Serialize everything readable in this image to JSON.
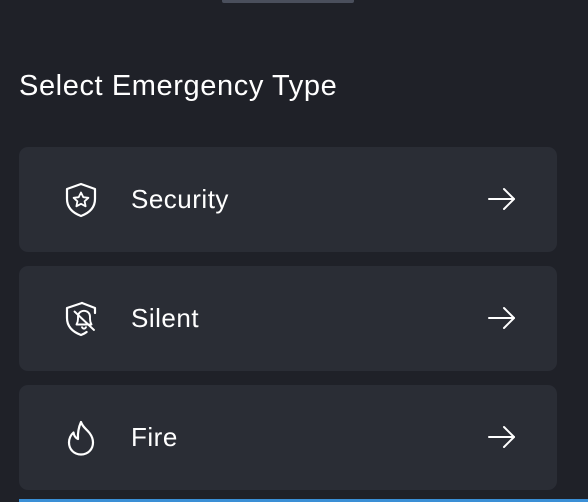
{
  "sheet": {
    "title": "Select Emergency Type"
  },
  "options": [
    {
      "label": "Security",
      "icon": "shield-star-icon"
    },
    {
      "label": "Silent",
      "icon": "shield-bell-off-icon"
    },
    {
      "label": "Fire",
      "icon": "flame-icon"
    }
  ],
  "colors": {
    "background": "#1f2128",
    "card": "#2a2d35",
    "text": "#ffffff",
    "accent": "#3a8fd6"
  }
}
